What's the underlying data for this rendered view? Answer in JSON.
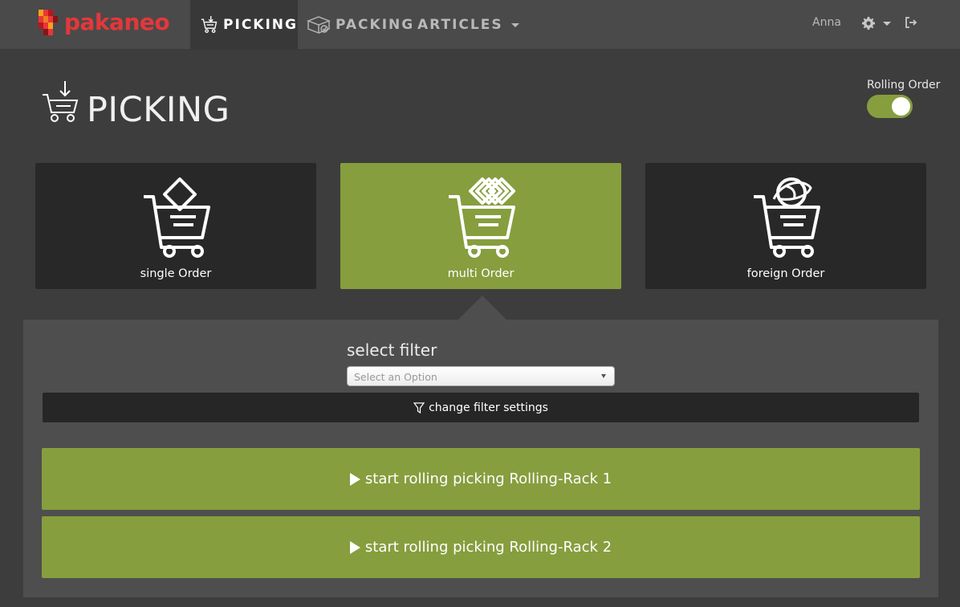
{
  "navbar": {
    "brand": "pakaneo",
    "tabs": [
      {
        "label": "PICKING",
        "icon": "cart-download-icon",
        "active": true
      },
      {
        "label": "PACKING",
        "icon": "box-icon",
        "active": false
      },
      {
        "label": "ARTICLES",
        "icon": "caret-down-icon",
        "active": false
      }
    ],
    "user": "Anna",
    "settings_icon": "gear-icon",
    "logout_icon": "logout-icon"
  },
  "header": {
    "title": "PICKING",
    "icon": "cart-download-icon",
    "rolling_order": {
      "label": "Rolling Order",
      "enabled": true
    }
  },
  "order_types": [
    {
      "label": "single Order",
      "icon": "cart-single-icon",
      "selected": false
    },
    {
      "label": "multi Order",
      "icon": "cart-multi-icon",
      "selected": true
    },
    {
      "label": "foreign Order",
      "icon": "cart-globe-icon",
      "selected": false
    }
  ],
  "filter": {
    "title": "select filter",
    "placeholder": "Select an Option",
    "settings_label": "change filter settings"
  },
  "racks": [
    {
      "label": "start rolling picking Rolling-Rack 1"
    },
    {
      "label": "start rolling picking Rolling-Rack 2"
    }
  ],
  "colors": {
    "accent": "#869e3e",
    "brand": "#e5373a",
    "navbar": "#4a4a4a",
    "background": "#3d3d3d",
    "tile": "#282828"
  }
}
